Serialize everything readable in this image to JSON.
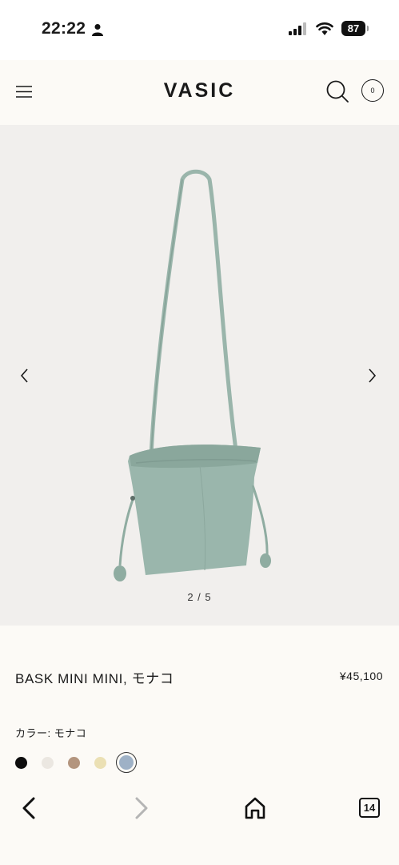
{
  "status_bar": {
    "time": "22:22",
    "battery": "87",
    "icons": [
      "person-icon",
      "signal-icon",
      "wifi-icon",
      "battery-icon"
    ]
  },
  "header": {
    "logo": "VASIC",
    "cart_count": "0",
    "icons": [
      "menu-icon",
      "search-icon",
      "cart-icon"
    ]
  },
  "gallery": {
    "counter": "2 / 5",
    "current_image": 2,
    "total_images": 5,
    "image": "product-photo (bucket bag, mint/sage green)",
    "icons": [
      "chevron-left-icon",
      "chevron-right-icon"
    ]
  },
  "product": {
    "name": "BASK MINI MINI, モナコ",
    "price": "¥45,100",
    "color_label": "カラー: モナコ",
    "swatches": [
      {
        "name": "black",
        "color": "#0d0d0d",
        "selected": false
      },
      {
        "name": "off-white",
        "color": "#ebe7e1",
        "selected": false
      },
      {
        "name": "taupe",
        "color": "#b3957e",
        "selected": false
      },
      {
        "name": "cream",
        "color": "#ebe0b4",
        "selected": false
      },
      {
        "name": "monaco",
        "color": "#9eb1c6",
        "selected": true
      }
    ]
  },
  "browser_bar": {
    "tab_count": "14",
    "icons": [
      "back-icon",
      "forward-icon",
      "home-icon",
      "tabs-icon"
    ]
  },
  "colors": {
    "header_bg": "#fcfaf6",
    "gallery_bg": "#f1efed",
    "bag": "#9bb6ac",
    "text": "#1a1a1a"
  }
}
